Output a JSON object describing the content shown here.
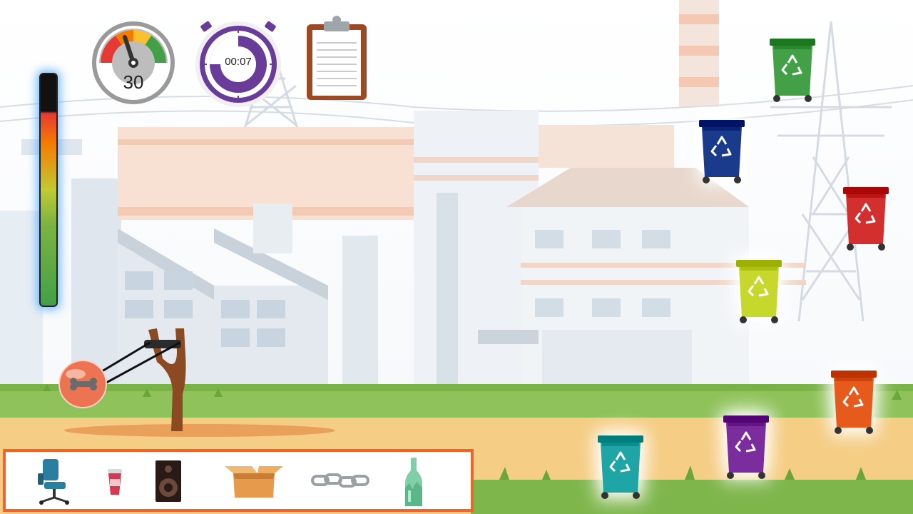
{
  "hud": {
    "speed_value": "30",
    "timer_label": "00:07"
  },
  "icons": {
    "power_meter": "power-meter",
    "speed_gauge": "speedometer-icon",
    "timer": "stopwatch-icon",
    "clipboard": "clipboard-icon",
    "slingshot": "slingshot",
    "projectile": "bone-ball"
  },
  "bins": [
    {
      "name": "green",
      "color": "#43a047"
    },
    {
      "name": "blue",
      "color": "#1a3b8c"
    },
    {
      "name": "red",
      "color": "#d32f2f"
    },
    {
      "name": "yellow-green",
      "color": "#c6d82c"
    },
    {
      "name": "orange",
      "color": "#e65a1c"
    },
    {
      "name": "purple",
      "color": "#7b2d9e"
    },
    {
      "name": "teal",
      "color": "#1fa5a5"
    }
  ],
  "tray_items": [
    "office-chair",
    "paper-cup",
    "speaker",
    "cardboard-box",
    "metal-chain",
    "broken-glass-bottle"
  ],
  "colors": {
    "sky": "#ffffff",
    "grass": "#8bc34a",
    "sand": "#f3c779",
    "tray_border": "#f0642a"
  }
}
